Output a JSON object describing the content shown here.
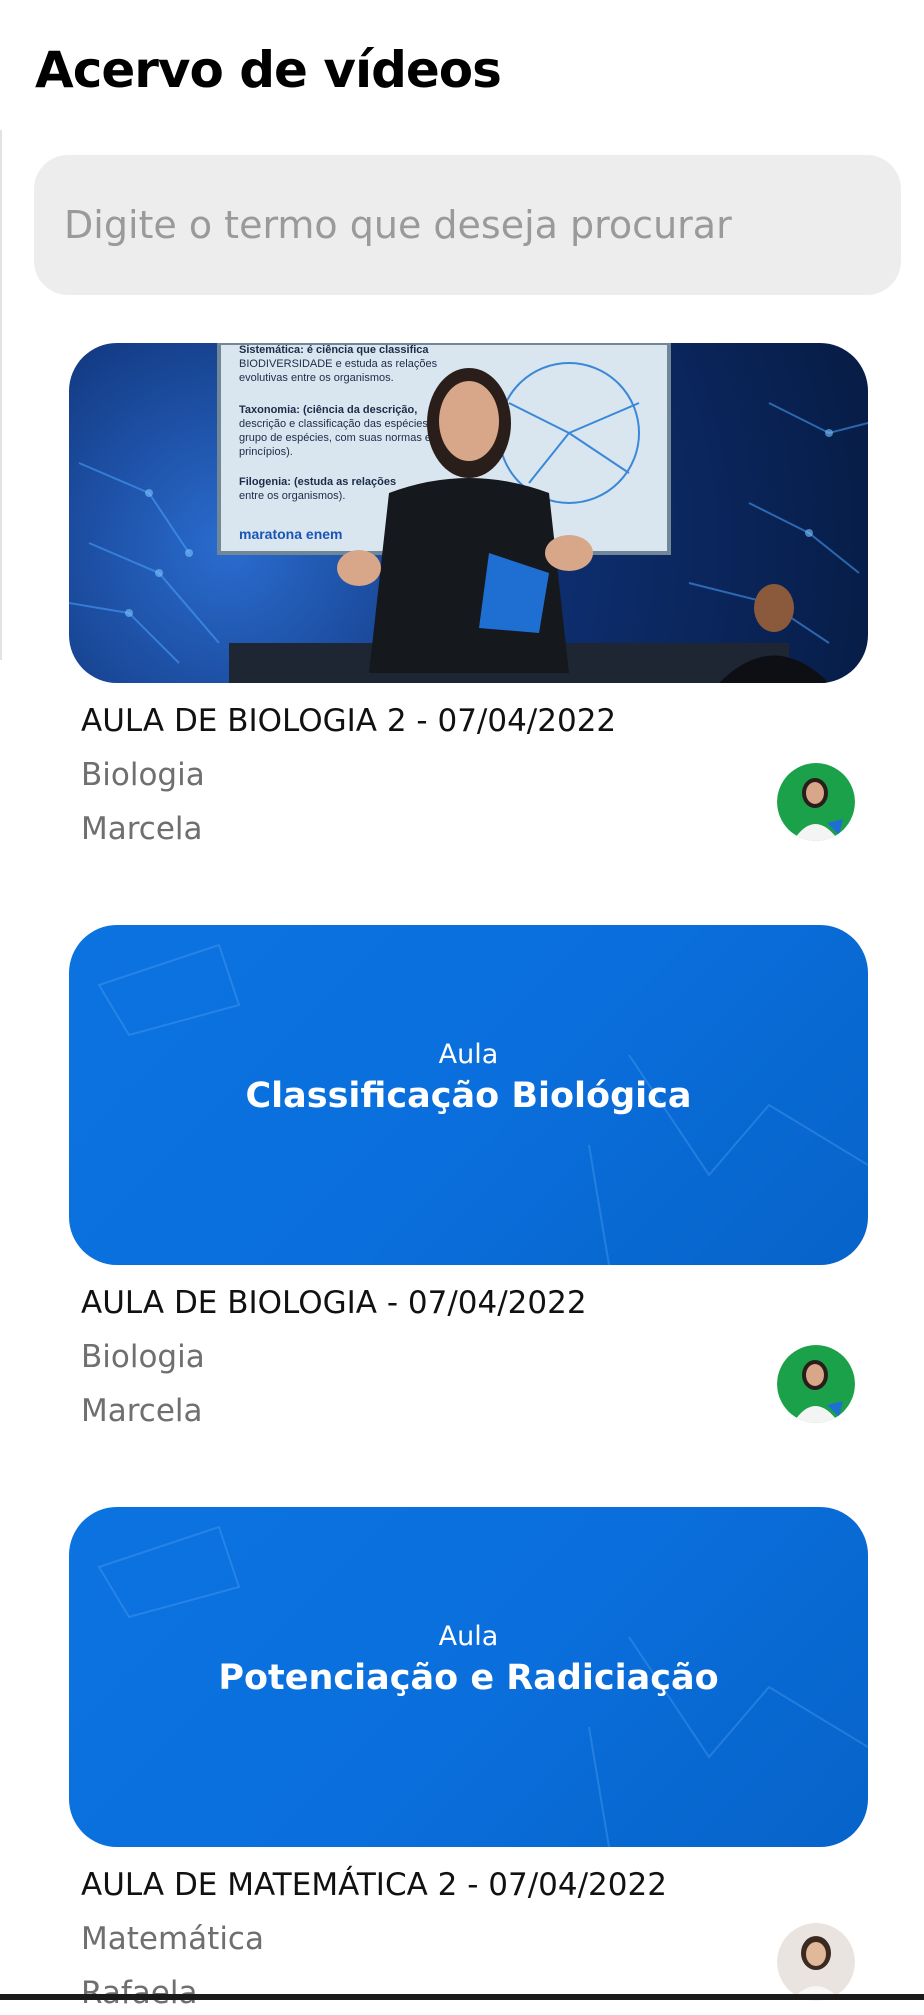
{
  "header": {
    "title": "Acervo de vídeos"
  },
  "search": {
    "placeholder": "Digite o termo que deseja procurar",
    "value": ""
  },
  "videos": [
    {
      "title": "AULA DE BIOLOGIA 2 - 07/04/2022",
      "subject": "Biologia",
      "teacher": "Marcela",
      "thumbnail": {
        "kind": "photo",
        "board_lines": [
          "Sistemática: é ciência que classifica",
          "BIODIVERSIDADE e estuda as relações",
          "evolutivas entre os organismos.",
          "Taxonomia: (ciência da descrição,",
          "descrição e classificação das espécies,",
          "grupo de espécies, com suas normas e",
          "princípios).",
          "Filogenia: (estuda as relações",
          "entre os organismos).",
          "maratona enem"
        ]
      }
    },
    {
      "title": "AULA DE BIOLOGIA - 07/04/2022",
      "subject": "Biologia",
      "teacher": "Marcela",
      "thumbnail": {
        "kind": "title-card",
        "small": "Aula",
        "big": "Classificação Biológica"
      }
    },
    {
      "title": "AULA DE MATEMÁTICA 2 - 07/04/2022",
      "subject": "Matemática",
      "teacher": "Rafaela",
      "thumbnail": {
        "kind": "title-card",
        "small": "Aula",
        "big": "Potenciação e Radiciação"
      }
    }
  ],
  "colors": {
    "accent_blue": "#0b73e0",
    "search_bg": "#ededed",
    "muted_text": "#6f6f6f",
    "avatar_green": "#1aa14a"
  }
}
